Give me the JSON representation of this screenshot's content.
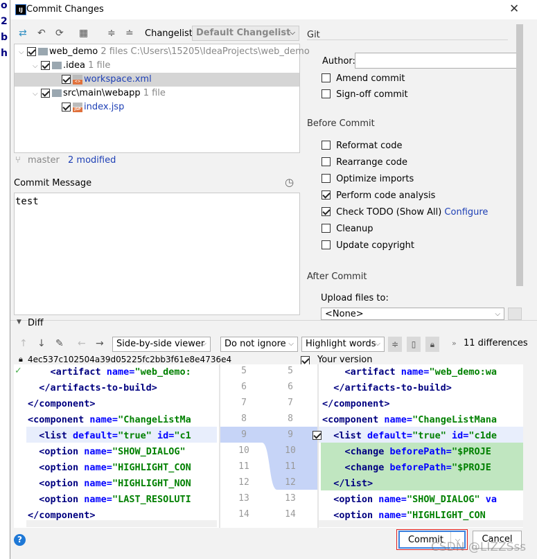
{
  "background_glyphs": [
    "o",
    "2",
    "b",
    "h"
  ],
  "window": {
    "title": "Commit Changes",
    "app_icon": "IJ"
  },
  "toolbar": {
    "changelist_label": "Changelist:",
    "changelist_value": "Default Changelist"
  },
  "tree": [
    {
      "name": "web_demo",
      "meta": "2 files",
      "path": "C:\\Users\\15205\\IdeaProjects\\web_demo",
      "level": 0,
      "type": "folder"
    },
    {
      "name": ".idea",
      "meta": "1 file",
      "level": 1,
      "type": "folder"
    },
    {
      "name": "workspace.xml",
      "level": 2,
      "type": "file",
      "badge": "<>",
      "selected": true
    },
    {
      "name": "src\\main\\webapp",
      "meta": "1 file",
      "level": 1,
      "type": "folder"
    },
    {
      "name": "index.jsp",
      "level": 2,
      "type": "file",
      "badge": "JSP"
    }
  ],
  "status": {
    "branch": "master",
    "modified": "2 modified"
  },
  "commit_message": {
    "label": "Commit Message",
    "value": "test"
  },
  "git": {
    "title": "Git",
    "author_label": "Author:",
    "author_value": "",
    "amend": "Amend commit",
    "signoff": "Sign-off commit"
  },
  "before_commit": {
    "title": "Before Commit",
    "options": [
      {
        "label": "Reformat code",
        "checked": false
      },
      {
        "label": "Rearrange code",
        "checked": false
      },
      {
        "label": "Optimize imports",
        "checked": false
      },
      {
        "label": "Perform code analysis",
        "checked": true
      },
      {
        "label": "Check TODO (Show All)",
        "checked": true,
        "link": "Configure"
      },
      {
        "label": "Cleanup",
        "checked": false
      },
      {
        "label": "Update copyright",
        "checked": false
      }
    ]
  },
  "after_commit": {
    "title": "After Commit",
    "upload_label": "Upload files to:",
    "upload_value": "<None>"
  },
  "diff": {
    "title": "Diff",
    "viewer": "Side-by-side viewer",
    "ignore": "Do not ignore",
    "highlight": "Highlight words",
    "differences": "11 differences",
    "left_revision": "4ec537c102504a39d05225fc2bb3f61e8e4736e4",
    "right_revision": "Your version",
    "left_numbers": [
      "5",
      "6",
      "7",
      "8",
      "9",
      "10",
      "11",
      "12",
      "13",
      "14"
    ],
    "right_numbers": [
      "5",
      "6",
      "7",
      "8",
      "9",
      "10",
      "11",
      "12",
      "13",
      "14"
    ],
    "left_lines": [
      [
        [
          "t",
          "    <artifact"
        ],
        [
          "a",
          " name="
        ],
        [
          "s",
          "\"web_demo:"
        ]
      ],
      [
        [
          "t",
          "  </artifacts-to-build>"
        ]
      ],
      [
        [
          "t",
          "</component>"
        ]
      ],
      [
        [
          "t",
          "<component"
        ],
        [
          "a",
          " name="
        ],
        [
          "s",
          "\"ChangeListMa"
        ]
      ],
      [
        [
          "t",
          "  <list"
        ],
        [
          "a",
          " default="
        ],
        [
          "s",
          "\"true\""
        ],
        [
          "a",
          " id="
        ],
        [
          "s",
          "\"c1"
        ]
      ],
      [
        [
          "t",
          "  <option"
        ],
        [
          "a",
          " name="
        ],
        [
          "s",
          "\"SHOW_DIALOG\""
        ]
      ],
      [
        [
          "t",
          "  <option"
        ],
        [
          "a",
          " name="
        ],
        [
          "s",
          "\"HIGHLIGHT_CON"
        ]
      ],
      [
        [
          "t",
          "  <option"
        ],
        [
          "a",
          " name="
        ],
        [
          "s",
          "\"HIGHLIGHT_NON"
        ]
      ],
      [
        [
          "t",
          "  <option"
        ],
        [
          "a",
          " name="
        ],
        [
          "s",
          "\"LAST_RESOLUTI"
        ]
      ],
      [
        [
          "t",
          "</component>"
        ]
      ]
    ],
    "right_lines": [
      [
        [
          "t",
          "    <artifact"
        ],
        [
          "a",
          " name="
        ],
        [
          "s",
          "\"web_demo:wa"
        ]
      ],
      [
        [
          "t",
          "  </artifacts-to-build>"
        ]
      ],
      [
        [
          "t",
          "</component>"
        ]
      ],
      [
        [
          "t",
          "<component"
        ],
        [
          "a",
          " name="
        ],
        [
          "s",
          "\"ChangeListMana"
        ]
      ],
      [
        [
          "t",
          "  <list"
        ],
        [
          "a",
          " default="
        ],
        [
          "s",
          "\"true\""
        ],
        [
          "a",
          " id="
        ],
        [
          "s",
          "\"c1de"
        ]
      ],
      [
        [
          "t",
          "    <change"
        ],
        [
          "a",
          " beforePath="
        ],
        [
          "s",
          "\"$PROJE"
        ]
      ],
      [
        [
          "t",
          "    <change"
        ],
        [
          "a",
          " beforePath="
        ],
        [
          "s",
          "\"$PROJE"
        ]
      ],
      [
        [
          "t",
          "  </list>"
        ]
      ],
      [
        [
          "t",
          "  <option"
        ],
        [
          "a",
          " name="
        ],
        [
          "s",
          "\"SHOW_DIALOG\""
        ],
        [
          "a",
          " va"
        ]
      ],
      [
        [
          "t",
          "  <option"
        ],
        [
          "a",
          " name="
        ],
        [
          "s",
          "\"HIGHLIGHT_CON"
        ]
      ]
    ]
  },
  "buttons": {
    "commit": "Commit",
    "cancel": "Cancel",
    "help": "?"
  },
  "watermark": "CSDN @LIZZSss",
  "colors": {
    "link": "#1d3fb5",
    "modified_bg": "#c6d4f7",
    "added_bg": "#c0e6c0",
    "commit_highlight": "#e02020"
  }
}
